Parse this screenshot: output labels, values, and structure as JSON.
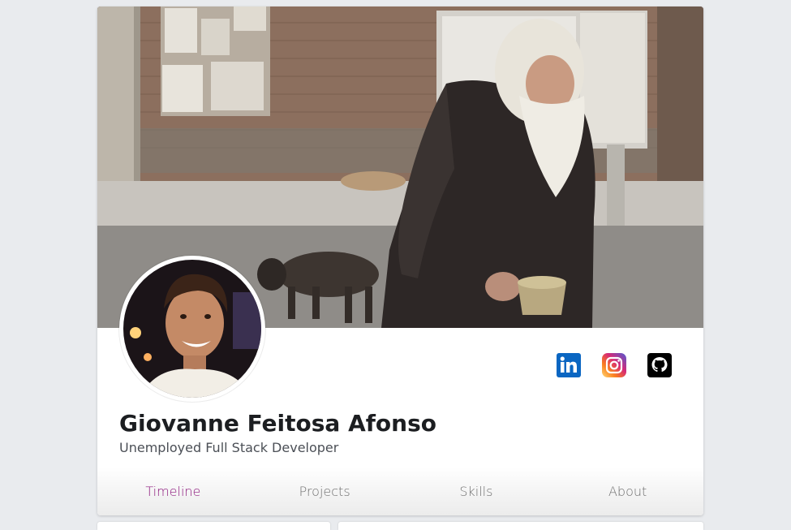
{
  "profile": {
    "name": "Giovanne Feitosa Afonso",
    "subtitle": "Unemployed Full Stack Developer"
  },
  "social": [
    {
      "icon": "linkedin-icon",
      "color": "#0a66c2"
    },
    {
      "icon": "instagram-icon",
      "color": "#e1306c"
    },
    {
      "icon": "github-icon",
      "color": "#000000"
    }
  ],
  "tabs": [
    {
      "label": "Timeline",
      "active": true
    },
    {
      "label": "Projects",
      "active": false
    },
    {
      "label": "Skills",
      "active": false
    },
    {
      "label": "About",
      "active": false
    }
  ],
  "colors": {
    "active_tab": "#8e1a7e",
    "inactive_tab": "#707070",
    "page_background": "#e9ebee"
  }
}
